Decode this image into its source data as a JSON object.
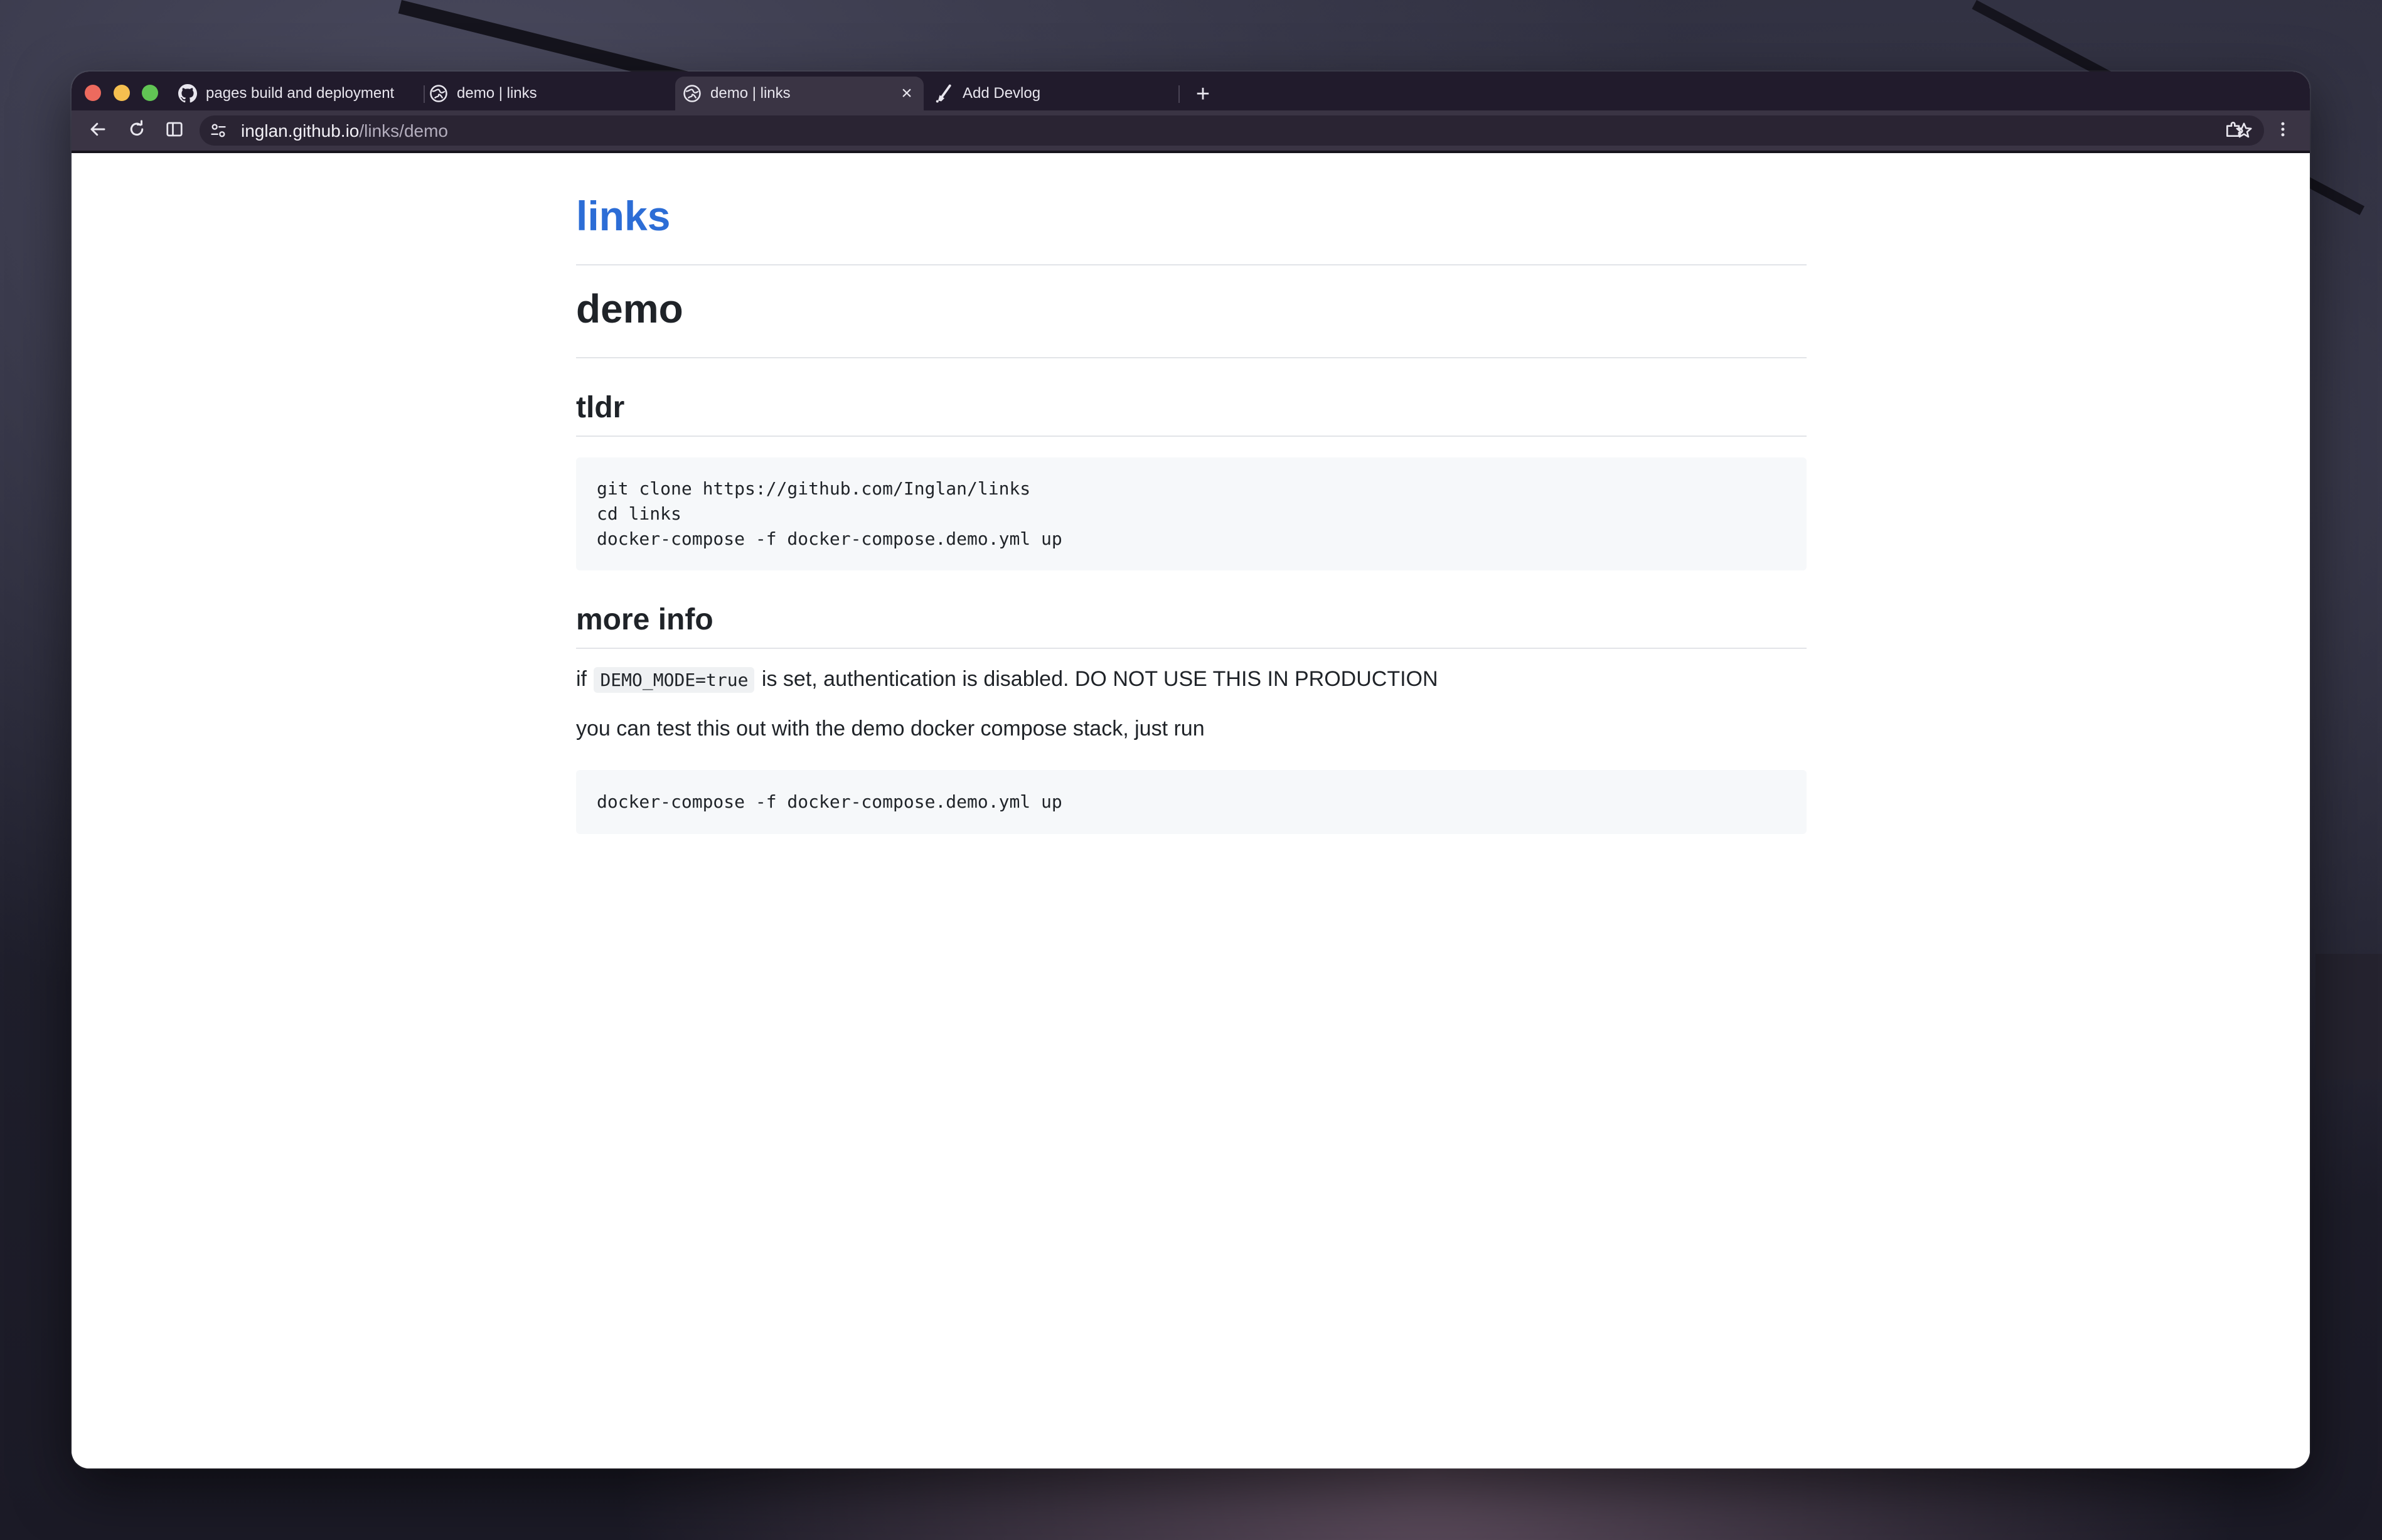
{
  "browser": {
    "tabs": [
      {
        "title": "pages build and deployment",
        "icon": "github-icon",
        "active": false
      },
      {
        "title": "demo | links",
        "icon": "globe-icon",
        "active": false
      },
      {
        "title": "demo | links",
        "icon": "globe-icon",
        "active": true
      },
      {
        "title": "Add Devlog",
        "icon": "devlog-icon",
        "active": false
      }
    ],
    "new_tab_label": "+",
    "close_label": "×",
    "url_host": "inglan.github.io",
    "url_path": "/links/demo"
  },
  "page": {
    "site_title": "links",
    "title": "demo",
    "sections": [
      {
        "heading": "tldr",
        "code": "git clone https://github.com/Inglan/links\ncd links\ndocker-compose -f docker-compose.demo.yml up"
      },
      {
        "heading": "more info",
        "para1_prefix": "if ",
        "para1_code": "DEMO_MODE=true",
        "para1_suffix": " is set, authentication is disabled. DO NOT USE THIS IN PRODUCTION",
        "para2": "you can test this out with the demo docker compose stack, just run",
        "code": "docker-compose -f docker-compose.demo.yml up"
      }
    ]
  },
  "colors": {
    "link_blue": "#2c6dd6",
    "tabstrip_bg": "#211b2c",
    "toolbar_bg": "#3a3444",
    "code_bg": "#f6f8fa"
  }
}
